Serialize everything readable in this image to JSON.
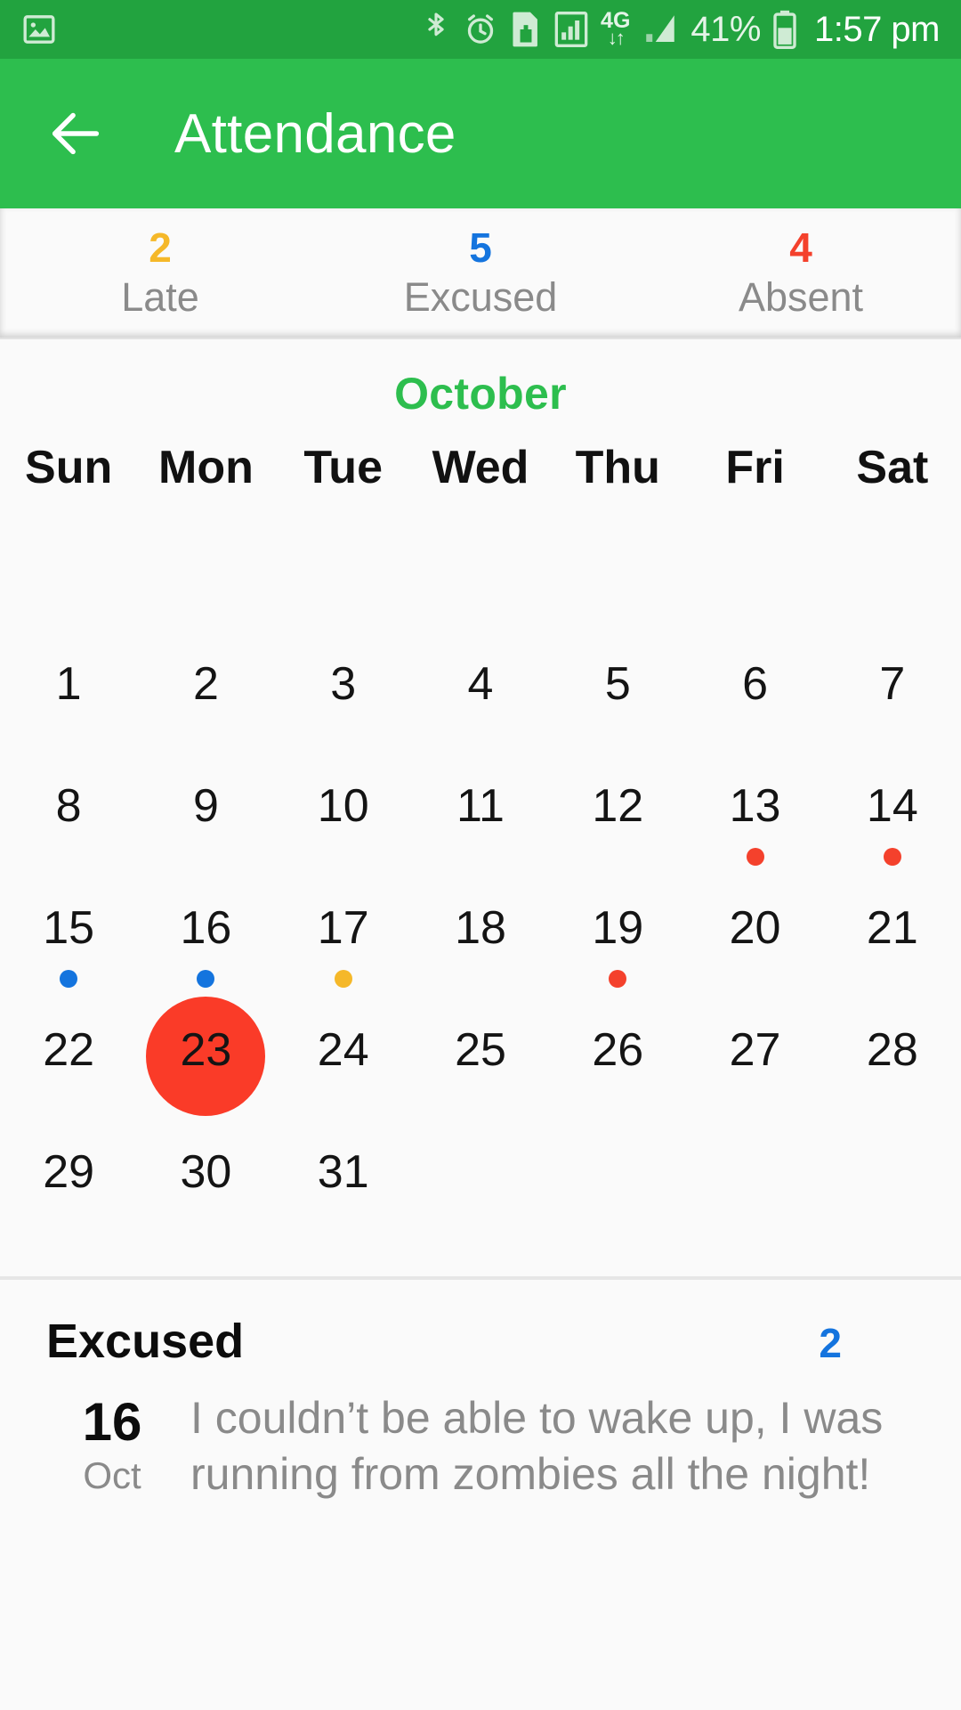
{
  "status_bar": {
    "icons": [
      "image-icon",
      "bluetooth-icon",
      "alarm-icon",
      "sim-card-icon",
      "signal-bars-icon",
      "data-4g-icon",
      "signal-strength-icon"
    ],
    "network_label": "4G",
    "battery_percent": "41%",
    "clock": "1:57 pm"
  },
  "app_bar": {
    "back_icon": "back-arrow-icon",
    "title": "Attendance"
  },
  "stats": [
    {
      "value": "2",
      "label": "Late",
      "color": "#F5B829"
    },
    {
      "value": "5",
      "label": "Excused",
      "color": "#1474DE"
    },
    {
      "value": "4",
      "label": "Absent",
      "color": "#F4412C"
    }
  ],
  "calendar": {
    "month": "October",
    "weekdays": [
      "Sun",
      "Mon",
      "Tue",
      "Wed",
      "Thu",
      "Fri",
      "Sat"
    ],
    "selected_day": 23,
    "selected_color": "#FA3B28",
    "dot_colors": {
      "late": "#F5B829",
      "excused": "#1474DE",
      "absent": "#F4412C"
    },
    "days": [
      {
        "n": "",
        "dot": null
      },
      {
        "n": "",
        "dot": null
      },
      {
        "n": "",
        "dot": null
      },
      {
        "n": "",
        "dot": null
      },
      {
        "n": "",
        "dot": null
      },
      {
        "n": "",
        "dot": null
      },
      {
        "n": "",
        "dot": null
      },
      {
        "n": "1",
        "dot": null
      },
      {
        "n": "2",
        "dot": null
      },
      {
        "n": "3",
        "dot": null
      },
      {
        "n": "4",
        "dot": null
      },
      {
        "n": "5",
        "dot": null
      },
      {
        "n": "6",
        "dot": null
      },
      {
        "n": "7",
        "dot": null
      },
      {
        "n": "8",
        "dot": null
      },
      {
        "n": "9",
        "dot": null
      },
      {
        "n": "10",
        "dot": null
      },
      {
        "n": "11",
        "dot": null
      },
      {
        "n": "12",
        "dot": null
      },
      {
        "n": "13",
        "dot": "absent"
      },
      {
        "n": "14",
        "dot": "absent"
      },
      {
        "n": "15",
        "dot": "excused"
      },
      {
        "n": "16",
        "dot": "excused"
      },
      {
        "n": "17",
        "dot": "late"
      },
      {
        "n": "18",
        "dot": null
      },
      {
        "n": "19",
        "dot": "absent"
      },
      {
        "n": "20",
        "dot": null
      },
      {
        "n": "21",
        "dot": null
      },
      {
        "n": "22",
        "dot": null
      },
      {
        "n": "23",
        "dot": null
      },
      {
        "n": "24",
        "dot": null
      },
      {
        "n": "25",
        "dot": null
      },
      {
        "n": "26",
        "dot": null
      },
      {
        "n": "27",
        "dot": null
      },
      {
        "n": "28",
        "dot": null
      },
      {
        "n": "29",
        "dot": null
      },
      {
        "n": "30",
        "dot": null
      },
      {
        "n": "31",
        "dot": null
      },
      {
        "n": "",
        "dot": null
      },
      {
        "n": "",
        "dot": null
      },
      {
        "n": "",
        "dot": null
      },
      {
        "n": "",
        "dot": null
      }
    ]
  },
  "detail": {
    "title": "Excused",
    "count": "2",
    "entries": [
      {
        "day": "16",
        "month": "Oct",
        "note": "I couldn’t be able to wake up, I was running from zombies all the night!"
      }
    ]
  }
}
